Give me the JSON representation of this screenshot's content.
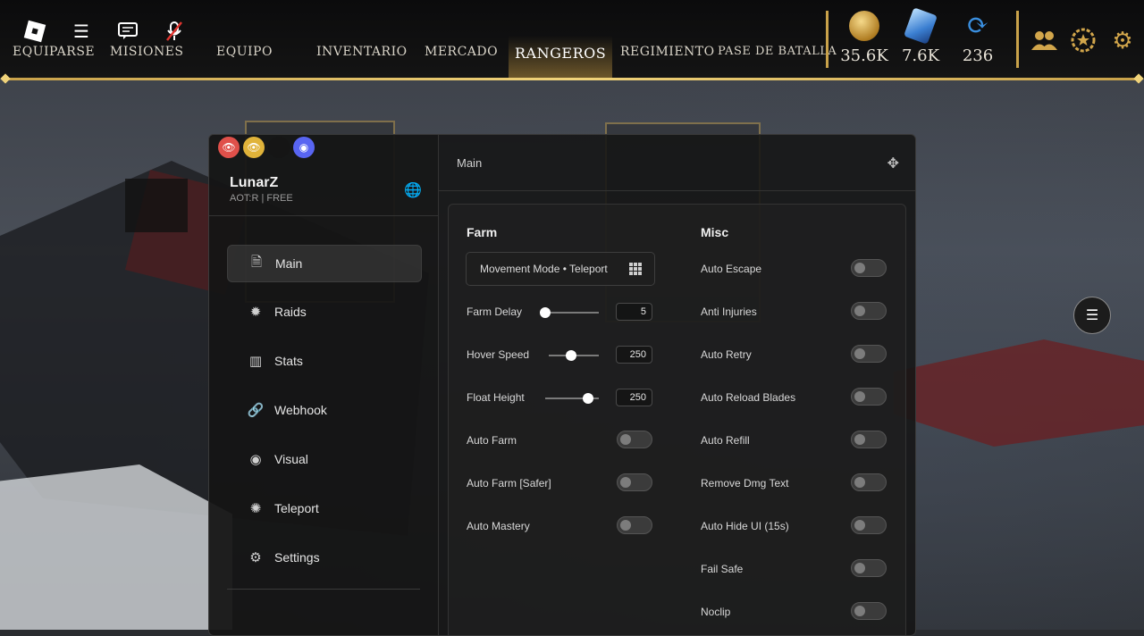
{
  "topbar": {
    "tabs": [
      "EQUIPARSE",
      "MISIONES",
      "EQUIPO",
      "INVENTARIO",
      "MERCADO",
      "RANGEROS",
      "REGIMIENTO",
      "PASE DE BATALLA"
    ],
    "active_tab": "RANGEROS",
    "currencies": [
      {
        "icon": "gold-coin-icon",
        "value": "35.6K"
      },
      {
        "icon": "crystal-icon",
        "value": "7.6K"
      },
      {
        "icon": "refresh-arrows-icon",
        "value": "236"
      }
    ],
    "right_icons": [
      "friends-icon",
      "rank-badge-icon",
      "settings-gear-icon"
    ]
  },
  "system_icons": [
    "roblox-logo-icon",
    "menu-icon",
    "chat-icon",
    "mic-muted-icon"
  ],
  "window": {
    "brand": "LunarZ",
    "subtitle": "AOT:R | FREE",
    "header_title": "Main",
    "nav": [
      {
        "label": "Main",
        "icon": "document-icon",
        "active": true
      },
      {
        "label": "Raids",
        "icon": "spider-icon",
        "active": false
      },
      {
        "label": "Stats",
        "icon": "bar-chart-icon",
        "active": false
      },
      {
        "label": "Webhook",
        "icon": "link-icon",
        "active": false
      },
      {
        "label": "Visual",
        "icon": "eye-icon",
        "active": false
      },
      {
        "label": "Teleport",
        "icon": "sparkle-icon",
        "active": false
      },
      {
        "label": "Settings",
        "icon": "gear-icon",
        "active": false
      }
    ],
    "farm": {
      "title": "Farm",
      "dropdown": "Movement Mode • Teleport",
      "sliders": [
        {
          "label": "Farm Delay",
          "value": "5",
          "fraction": 0.0
        },
        {
          "label": "Hover Speed",
          "value": "250",
          "fraction": 0.45
        },
        {
          "label": "Float Height",
          "value": "250",
          "fraction": 0.8
        }
      ],
      "toggles": [
        "Auto Farm",
        "Auto Farm [Safer]",
        "Auto Mastery"
      ]
    },
    "misc": {
      "title": "Misc",
      "toggles": [
        "Auto Escape",
        "Anti Injuries",
        "Auto Retry",
        "Auto Reload Blades",
        "Auto Refill",
        "Remove Dmg Text",
        "Auto Hide UI (15s)",
        "Fail Safe",
        "Noclip"
      ]
    }
  },
  "colors": {
    "gold": "#c9a24a",
    "panel": "#141414"
  }
}
